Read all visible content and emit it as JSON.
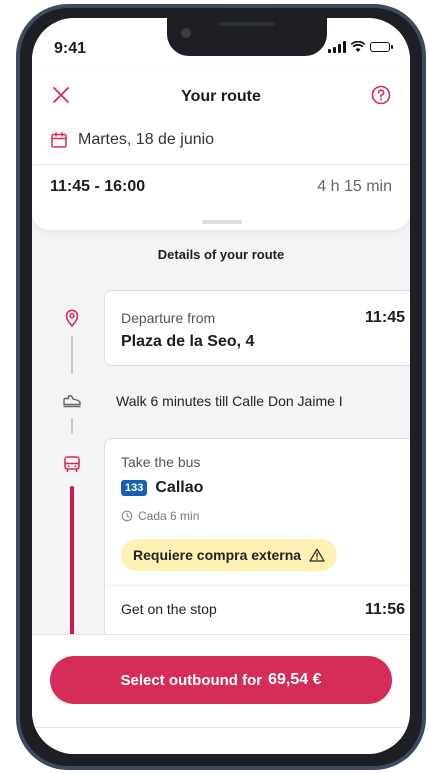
{
  "status_bar": {
    "time": "9:41"
  },
  "header": {
    "title": "Your route"
  },
  "trip": {
    "date": "Martes, 18 de junio",
    "time_range": "11:45 - 16:00",
    "duration": "4 h 15 min"
  },
  "details": {
    "section_title": "Details of your route",
    "departure": {
      "label": "Departure from",
      "time": "11:45",
      "place": "Plaza de la Seo, 4"
    },
    "walk": {
      "text": "Walk 6 minutes till Calle Don Jaime I"
    },
    "bus": {
      "label": "Take the bus",
      "line_number": "133",
      "line_name": "Callao",
      "frequency": "Cada 6 min",
      "notice": "Requiere compra externa",
      "stop_label": "Get on the stop",
      "stop_time": "11:56"
    }
  },
  "cta": {
    "label": "Select outbound for",
    "price": "69,54 €"
  },
  "colors": {
    "accent": "#d42d57",
    "bus_line": "#c91a45",
    "line_badge": "#1a5fb4",
    "notice_bg": "#fdf2b3"
  },
  "icons": [
    "close-icon",
    "help-icon",
    "calendar-icon",
    "location-pin-icon",
    "walk-shoe-icon",
    "bus-icon",
    "clock-icon",
    "warning-icon"
  ]
}
